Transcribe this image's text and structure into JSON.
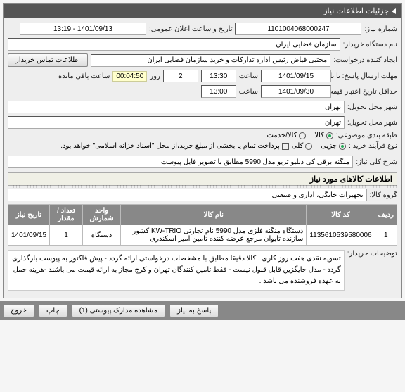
{
  "panel_header": "جزئیات اطلاعات نیاز",
  "labels": {
    "need_no": "شماره نیاز:",
    "announce_dt": "تاریخ و ساعت اعلان عمومی:",
    "buyer_org": "نام دستگاه خریدار:",
    "creator": "ایجاد کننده درخواست:",
    "contact_btn": "اطلاعات تماس خریدار",
    "deadline_send": "حداقل",
    "deadline_send2": "مهلت ارسال پاسخ: تا تاریخ:",
    "hour": "ساعت",
    "day": "روز",
    "remaining": "ساعت باقی مانده",
    "deadline_valid": "حداقل تاریخ اعتبار قیمت: تا تاریخ:",
    "city_inquiry": "شهر محل تحویل:",
    "city_deliver": "شهر محل تحویل:",
    "goods_class": "طبقه بندی موضوعی:",
    "goods": "کالا",
    "service": "کالا/خدمت",
    "purchase_type": "نوع فرآیند خرید :",
    "partial": "جزیی",
    "total": "کلی",
    "payment_note": "پرداخت تمام یا بخشی از مبلغ خرید،از محل \"اسناد خزانه اسلامی\" خواهد بود.",
    "title_label": "شرح کلی نیاز:",
    "goods_group_label": "گروه کالا:",
    "buyer_notes_label": "توضیحات خریدار:",
    "items_header": "اطلاعات کالاهای مورد نیاز"
  },
  "fields": {
    "need_no": "1101004068000247",
    "announce_dt": "1401/09/13 - 13:19",
    "buyer_org": "سازمان فضایی ایران",
    "creator": "مجتبی  فیاض رئیس اداره تدارکات و خرید سازمان فضایی ایران",
    "deadline_send_date": "1401/09/15",
    "deadline_send_hour": "13:30",
    "days_remain": "2",
    "countdown": "00:04:50",
    "deadline_valid_date": "1401/09/30",
    "deadline_valid_hour": "13:00",
    "city_inquiry": "تهران",
    "city_deliver": "تهران",
    "title": "منگنه برقی کی دبلیو تریو مدل 5990 مطابق با تصویر فایل پیوست",
    "goods_group": "تجهیزات خانگی، اداری و صنعتی",
    "buyer_notes": "تسویه نقدی هفت روز کاری . کالا دقیقا مطابق با مشخصات درخواستی ارائه گردد - پیش فاکتور به پیوست بارگذاری گردد - مدل جایگزین قابل قبول نیست - فقط تامین کنندگان تهران و کرج مجاز به ارائه قیمت می باشند -هزینه حمل به عهده فروشنده می باشد ."
  },
  "table": {
    "headers": [
      "ردیف",
      "کد کالا",
      "نام کالا",
      "واحد شمارش",
      "تعداد / مقدار",
      "تاریخ نیاز"
    ],
    "rows": [
      {
        "idx": "1",
        "code": "1135610539580006",
        "name": "دستگاه منگنه فلزی مدل 5990 نام تجارتی KW-TRIO کشور سازنده تایوان مرجع عرضه کننده تامین امیر اسکندری",
        "unit": "دستگاه",
        "qty": "1",
        "date": "1401/09/15"
      }
    ]
  },
  "buttons": {
    "reply": "پاسخ به نیاز",
    "attachments": "مشاهده مدارک پیوستی (1)",
    "print": "چاپ",
    "exit": "خروج"
  }
}
